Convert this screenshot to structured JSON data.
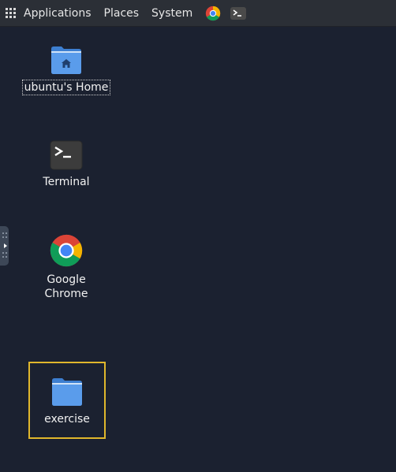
{
  "topbar": {
    "menus": [
      {
        "label": "Applications"
      },
      {
        "label": "Places"
      },
      {
        "label": "System"
      }
    ],
    "launchers": [
      {
        "icon": "chrome-icon"
      },
      {
        "icon": "terminal-icon"
      }
    ]
  },
  "desktop": {
    "icons": [
      {
        "label": "ubuntu's Home",
        "icon": "home-folder-icon"
      },
      {
        "label": "Terminal",
        "icon": "terminal-icon"
      },
      {
        "label": "Google Chrome",
        "icon": "chrome-icon"
      },
      {
        "label": "exercise",
        "icon": "folder-icon",
        "selected": true
      }
    ]
  },
  "colors": {
    "desktop_bg": "#1b2130",
    "panel_bg": "#2b2f36",
    "folder_blue": "#4a90e2",
    "selection_outline": "#e0b72c"
  }
}
